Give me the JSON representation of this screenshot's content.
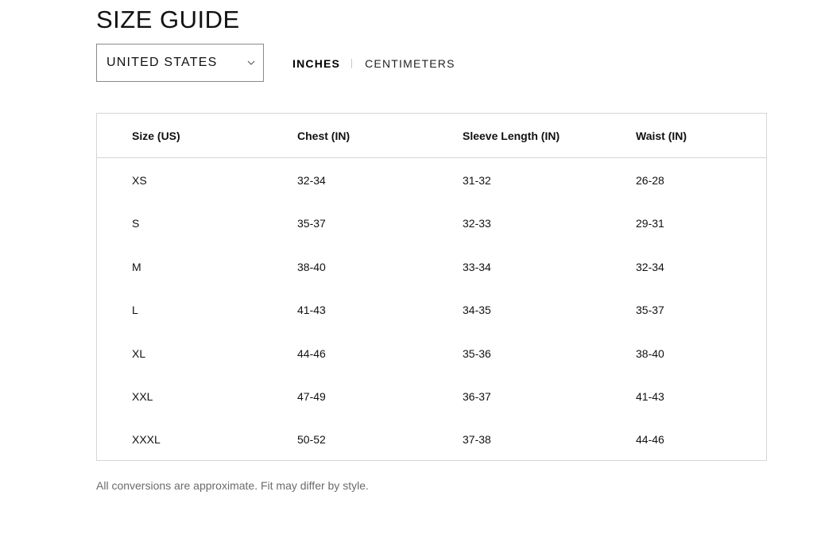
{
  "page": {
    "title": "SIZE GUIDE"
  },
  "region_select": {
    "value": "UNITED STATES",
    "icon": "chevron-down-icon"
  },
  "units": {
    "options": [
      {
        "label": "INCHES",
        "active": true
      },
      {
        "label": "CENTIMETERS",
        "active": false
      }
    ]
  },
  "table": {
    "headers": [
      "Size (US)",
      "Chest (IN)",
      "Sleeve Length (IN)",
      "Waist (IN)"
    ],
    "rows": [
      [
        "XS",
        "32-34",
        "31-32",
        "26-28"
      ],
      [
        "S",
        "35-37",
        "32-33",
        "29-31"
      ],
      [
        "M",
        "38-40",
        "33-34",
        "32-34"
      ],
      [
        "L",
        "41-43",
        "34-35",
        "35-37"
      ],
      [
        "XL",
        "44-46",
        "35-36",
        "38-40"
      ],
      [
        "XXL",
        "47-49",
        "36-37",
        "41-43"
      ],
      [
        "XXXL",
        "50-52",
        "37-38",
        "44-46"
      ]
    ]
  },
  "footnote": "All conversions are approximate. Fit may differ by style."
}
